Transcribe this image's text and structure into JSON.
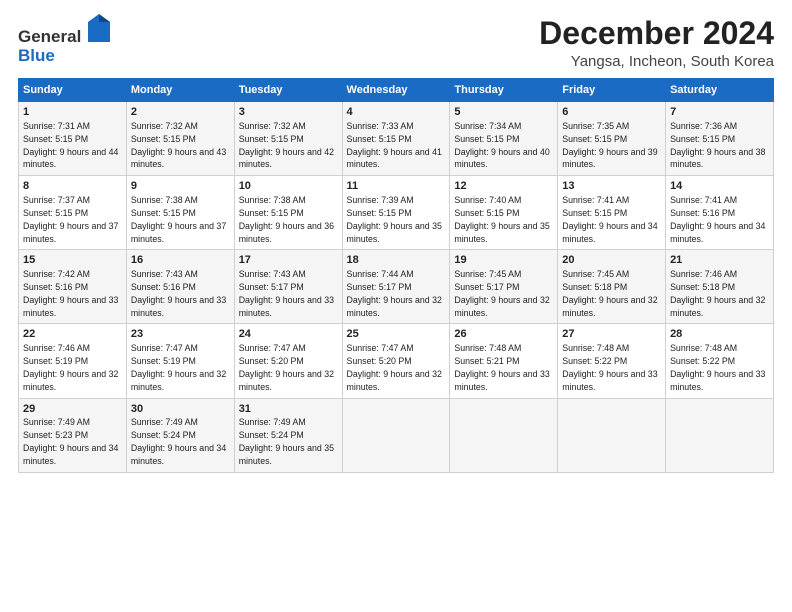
{
  "header": {
    "logo_general": "General",
    "logo_blue": "Blue",
    "title": "December 2024",
    "subtitle": "Yangsa, Incheon, South Korea"
  },
  "days_of_week": [
    "Sunday",
    "Monday",
    "Tuesday",
    "Wednesday",
    "Thursday",
    "Friday",
    "Saturday"
  ],
  "weeks": [
    [
      {
        "day": 1,
        "sunrise": "7:31 AM",
        "sunset": "5:15 PM",
        "daylight": "9 hours and 44 minutes."
      },
      {
        "day": 2,
        "sunrise": "7:32 AM",
        "sunset": "5:15 PM",
        "daylight": "9 hours and 43 minutes."
      },
      {
        "day": 3,
        "sunrise": "7:32 AM",
        "sunset": "5:15 PM",
        "daylight": "9 hours and 42 minutes."
      },
      {
        "day": 4,
        "sunrise": "7:33 AM",
        "sunset": "5:15 PM",
        "daylight": "9 hours and 41 minutes."
      },
      {
        "day": 5,
        "sunrise": "7:34 AM",
        "sunset": "5:15 PM",
        "daylight": "9 hours and 40 minutes."
      },
      {
        "day": 6,
        "sunrise": "7:35 AM",
        "sunset": "5:15 PM",
        "daylight": "9 hours and 39 minutes."
      },
      {
        "day": 7,
        "sunrise": "7:36 AM",
        "sunset": "5:15 PM",
        "daylight": "9 hours and 38 minutes."
      }
    ],
    [
      {
        "day": 8,
        "sunrise": "7:37 AM",
        "sunset": "5:15 PM",
        "daylight": "9 hours and 37 minutes."
      },
      {
        "day": 9,
        "sunrise": "7:38 AM",
        "sunset": "5:15 PM",
        "daylight": "9 hours and 37 minutes."
      },
      {
        "day": 10,
        "sunrise": "7:38 AM",
        "sunset": "5:15 PM",
        "daylight": "9 hours and 36 minutes."
      },
      {
        "day": 11,
        "sunrise": "7:39 AM",
        "sunset": "5:15 PM",
        "daylight": "9 hours and 35 minutes."
      },
      {
        "day": 12,
        "sunrise": "7:40 AM",
        "sunset": "5:15 PM",
        "daylight": "9 hours and 35 minutes."
      },
      {
        "day": 13,
        "sunrise": "7:41 AM",
        "sunset": "5:15 PM",
        "daylight": "9 hours and 34 minutes."
      },
      {
        "day": 14,
        "sunrise": "7:41 AM",
        "sunset": "5:16 PM",
        "daylight": "9 hours and 34 minutes."
      }
    ],
    [
      {
        "day": 15,
        "sunrise": "7:42 AM",
        "sunset": "5:16 PM",
        "daylight": "9 hours and 33 minutes."
      },
      {
        "day": 16,
        "sunrise": "7:43 AM",
        "sunset": "5:16 PM",
        "daylight": "9 hours and 33 minutes."
      },
      {
        "day": 17,
        "sunrise": "7:43 AM",
        "sunset": "5:17 PM",
        "daylight": "9 hours and 33 minutes."
      },
      {
        "day": 18,
        "sunrise": "7:44 AM",
        "sunset": "5:17 PM",
        "daylight": "9 hours and 32 minutes."
      },
      {
        "day": 19,
        "sunrise": "7:45 AM",
        "sunset": "5:17 PM",
        "daylight": "9 hours and 32 minutes."
      },
      {
        "day": 20,
        "sunrise": "7:45 AM",
        "sunset": "5:18 PM",
        "daylight": "9 hours and 32 minutes."
      },
      {
        "day": 21,
        "sunrise": "7:46 AM",
        "sunset": "5:18 PM",
        "daylight": "9 hours and 32 minutes."
      }
    ],
    [
      {
        "day": 22,
        "sunrise": "7:46 AM",
        "sunset": "5:19 PM",
        "daylight": "9 hours and 32 minutes."
      },
      {
        "day": 23,
        "sunrise": "7:47 AM",
        "sunset": "5:19 PM",
        "daylight": "9 hours and 32 minutes."
      },
      {
        "day": 24,
        "sunrise": "7:47 AM",
        "sunset": "5:20 PM",
        "daylight": "9 hours and 32 minutes."
      },
      {
        "day": 25,
        "sunrise": "7:47 AM",
        "sunset": "5:20 PM",
        "daylight": "9 hours and 32 minutes."
      },
      {
        "day": 26,
        "sunrise": "7:48 AM",
        "sunset": "5:21 PM",
        "daylight": "9 hours and 33 minutes."
      },
      {
        "day": 27,
        "sunrise": "7:48 AM",
        "sunset": "5:22 PM",
        "daylight": "9 hours and 33 minutes."
      },
      {
        "day": 28,
        "sunrise": "7:48 AM",
        "sunset": "5:22 PM",
        "daylight": "9 hours and 33 minutes."
      }
    ],
    [
      {
        "day": 29,
        "sunrise": "7:49 AM",
        "sunset": "5:23 PM",
        "daylight": "9 hours and 34 minutes."
      },
      {
        "day": 30,
        "sunrise": "7:49 AM",
        "sunset": "5:24 PM",
        "daylight": "9 hours and 34 minutes."
      },
      {
        "day": 31,
        "sunrise": "7:49 AM",
        "sunset": "5:24 PM",
        "daylight": "9 hours and 35 minutes."
      },
      null,
      null,
      null,
      null
    ]
  ]
}
